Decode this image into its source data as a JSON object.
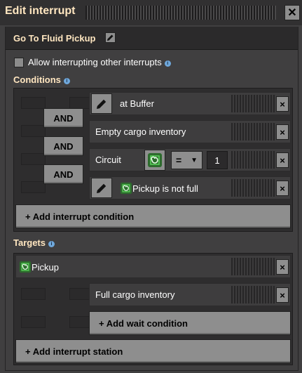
{
  "window": {
    "title": "Edit interrupt",
    "close_label": "✕"
  },
  "interrupt": {
    "name": "Go To Fluid Pickup"
  },
  "allow_interrupting": {
    "label": "Allow interrupting other interrupts",
    "checked": false
  },
  "conditions": {
    "heading": "Conditions",
    "rows": [
      {
        "text": "at Buffer",
        "has_edit": true
      },
      {
        "text": "Empty cargo inventory"
      },
      {
        "text": "Circuit",
        "comparator": "=",
        "value": "1"
      },
      {
        "text": "Pickup is not full",
        "has_edit": true
      }
    ],
    "and_labels": [
      "AND",
      "AND",
      "AND"
    ],
    "add_label": "+ Add interrupt condition"
  },
  "targets": {
    "heading": "Targets",
    "station": {
      "name": "Pickup"
    },
    "wait_conditions": [
      {
        "text": "Full cargo inventory"
      }
    ],
    "add_wait_label": "+ Add wait condition",
    "add_station_label": "+ Add interrupt station"
  },
  "icons": {
    "remove": "×",
    "info": "i",
    "dropdown": "▼"
  },
  "colors": {
    "title": "#ffe6c0",
    "signal": "#5ad15a",
    "info": "#6fa8dc"
  }
}
